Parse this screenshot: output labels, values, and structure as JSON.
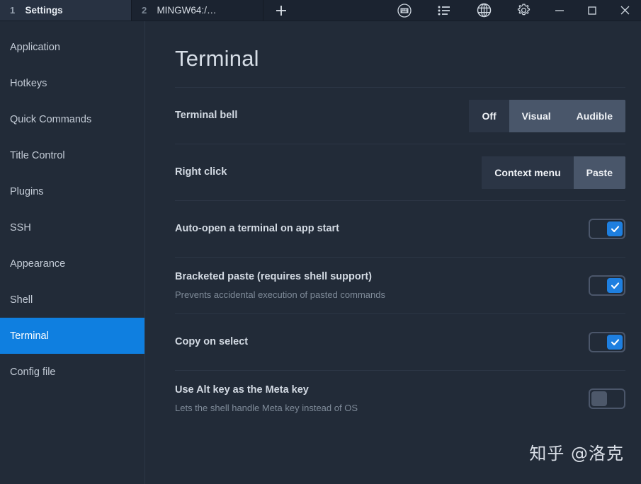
{
  "window": {
    "tabs": [
      {
        "index": "1",
        "title": "Settings",
        "active": true
      },
      {
        "index": "2",
        "title": "MINGW64:/…",
        "active": false
      }
    ],
    "new_tab_label": "+",
    "toolbar_icons": [
      {
        "name": "keyboard-icon",
        "label": "Keyboard"
      },
      {
        "name": "list-icon",
        "label": "Task list"
      },
      {
        "name": "globe-icon",
        "label": "Globe"
      },
      {
        "name": "gear-icon",
        "label": "Settings"
      }
    ],
    "window_controls": [
      {
        "name": "minimize-icon",
        "label": "Minimize"
      },
      {
        "name": "maximize-icon",
        "label": "Maximize"
      },
      {
        "name": "close-icon",
        "label": "Close"
      }
    ]
  },
  "sidebar": {
    "items": [
      {
        "label": "Application",
        "active": false
      },
      {
        "label": "Hotkeys",
        "active": false
      },
      {
        "label": "Quick Commands",
        "active": false
      },
      {
        "label": "Title Control",
        "active": false
      },
      {
        "label": "Plugins",
        "active": false
      },
      {
        "label": "SSH",
        "active": false
      },
      {
        "label": "Appearance",
        "active": false
      },
      {
        "label": "Shell",
        "active": false
      },
      {
        "label": "Terminal",
        "active": true
      },
      {
        "label": "Config file",
        "active": false
      }
    ]
  },
  "main": {
    "title": "Terminal",
    "rows": [
      {
        "label": "Terminal bell",
        "desc": "",
        "control": "segmented",
        "options": [
          {
            "label": "Off",
            "selected": true
          },
          {
            "label": "Visual",
            "selected": false
          },
          {
            "label": "Audible",
            "selected": false
          }
        ]
      },
      {
        "label": "Right click",
        "desc": "",
        "control": "segmented",
        "options": [
          {
            "label": "Context menu",
            "selected": true
          },
          {
            "label": "Paste",
            "selected": false
          }
        ]
      },
      {
        "label": "Auto-open a terminal on app start",
        "desc": "",
        "control": "toggle",
        "value": true
      },
      {
        "label": "Bracketed paste (requires shell support)",
        "desc": "Prevents accidental execution of pasted commands",
        "control": "toggle",
        "value": true
      },
      {
        "label": "Copy on select",
        "desc": "",
        "control": "toggle",
        "value": true
      },
      {
        "label": "Use Alt key as the Meta key",
        "desc": "Lets the shell handle Meta key instead of OS",
        "control": "toggle",
        "value": false
      }
    ]
  },
  "watermark": {
    "text": "知乎 @洛克"
  },
  "colors": {
    "accent": "#0f7fe0",
    "toggle_on": "#1e7fe0",
    "background": "#222b38",
    "titlebar": "#1b2330",
    "segment_bg": "#49566a",
    "segment_selected": "#2b3545"
  }
}
